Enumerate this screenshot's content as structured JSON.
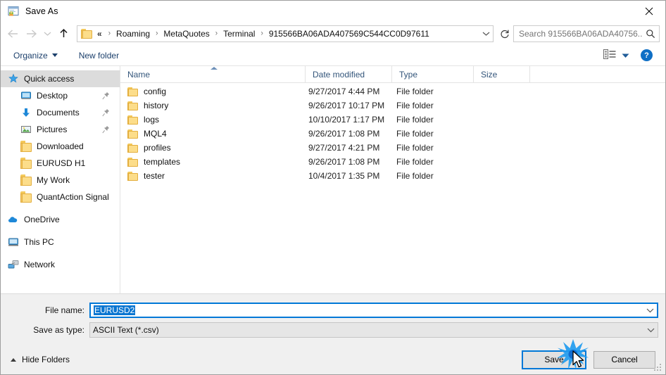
{
  "window": {
    "title": "Save As",
    "app_icon": "save-as-app-icon",
    "close_label": "✕"
  },
  "nav": {
    "back_icon": "back-arrow-icon",
    "forward_icon": "forward-arrow-icon",
    "history_icon": "chevron-down-icon",
    "up_icon": "up-arrow-icon",
    "folder_icon": "folder-icon",
    "overflow": "«",
    "crumbs": [
      "Roaming",
      "MetaQuotes",
      "Terminal",
      "915566BA06ADA407569C544CC0D97611"
    ],
    "separator": "›",
    "address_chevron_icon": "chevron-down-icon",
    "refresh_icon": "refresh-icon"
  },
  "search": {
    "placeholder": "Search 915566BA06ADA40756...",
    "icon": "search-icon"
  },
  "toolbar": {
    "organize_label": "Organize",
    "new_folder_label": "New folder",
    "view_icon": "view-layout-icon",
    "view_caret_icon": "chevron-down-icon",
    "help_label": "?",
    "help_icon": "help-icon"
  },
  "sidebar": {
    "items": [
      {
        "label": "Quick access",
        "icon": "star-pin-icon",
        "selected": true,
        "indent": false,
        "pinned": false,
        "group": false
      },
      {
        "label": "Desktop",
        "icon": "desktop-icon",
        "selected": false,
        "indent": true,
        "pinned": true,
        "group": false
      },
      {
        "label": "Documents",
        "icon": "documents-icon",
        "selected": false,
        "indent": true,
        "pinned": true,
        "group": false
      },
      {
        "label": "Pictures",
        "icon": "pictures-icon",
        "selected": false,
        "indent": true,
        "pinned": true,
        "group": false
      },
      {
        "label": "Downloaded",
        "icon": "folder-icon",
        "selected": false,
        "indent": true,
        "pinned": false,
        "group": false
      },
      {
        "label": "EURUSD H1",
        "icon": "folder-icon",
        "selected": false,
        "indent": true,
        "pinned": false,
        "group": false
      },
      {
        "label": "My Work",
        "icon": "folder-icon",
        "selected": false,
        "indent": true,
        "pinned": false,
        "group": false
      },
      {
        "label": "QuantAction Signal",
        "icon": "folder-icon",
        "selected": false,
        "indent": true,
        "pinned": false,
        "group": false
      },
      {
        "label": "OneDrive",
        "icon": "onedrive-cloud-icon",
        "selected": false,
        "indent": false,
        "pinned": false,
        "group": true
      },
      {
        "label": "This PC",
        "icon": "this-pc-icon",
        "selected": false,
        "indent": false,
        "pinned": false,
        "group": true
      },
      {
        "label": "Network",
        "icon": "network-icon",
        "selected": false,
        "indent": false,
        "pinned": false,
        "group": true
      }
    ]
  },
  "filelist": {
    "columns": [
      "Name",
      "Date modified",
      "Type",
      "Size"
    ],
    "sort_column": "Name",
    "sort_direction": "ascending",
    "rows": [
      {
        "name": "config",
        "date": "9/27/2017 4:44 PM",
        "type": "File folder",
        "size": ""
      },
      {
        "name": "history",
        "date": "9/26/2017 10:17 PM",
        "type": "File folder",
        "size": ""
      },
      {
        "name": "logs",
        "date": "10/10/2017 1:17 PM",
        "type": "File folder",
        "size": ""
      },
      {
        "name": "MQL4",
        "date": "9/26/2017 1:08 PM",
        "type": "File folder",
        "size": ""
      },
      {
        "name": "profiles",
        "date": "9/27/2017 4:21 PM",
        "type": "File folder",
        "size": ""
      },
      {
        "name": "templates",
        "date": "9/26/2017 1:08 PM",
        "type": "File folder",
        "size": ""
      },
      {
        "name": "tester",
        "date": "10/4/2017 1:35 PM",
        "type": "File folder",
        "size": ""
      }
    ]
  },
  "form": {
    "filename_label": "File name:",
    "filename_value": "EURUSD2",
    "filetype_label": "Save as type:",
    "filetype_value": "ASCII Text (*.csv)",
    "chevron_icon": "chevron-down-icon"
  },
  "footer": {
    "hide_folders_label": "Hide Folders",
    "hide_folders_icon": "chevron-up-icon",
    "save_label": "Save",
    "cancel_label": "Cancel",
    "resize_grip_icon": "resize-grip-icon",
    "click_effect_icon": "click-burst-icon",
    "cursor_icon": "mouse-cursor-icon"
  },
  "colors": {
    "accent": "#0078d7",
    "selection": "#0b76d1",
    "header_text": "#33557a",
    "toolbar_text": "#1b3f6b",
    "folder": "#fcdd8a",
    "form_bg": "#f0f0f0"
  }
}
